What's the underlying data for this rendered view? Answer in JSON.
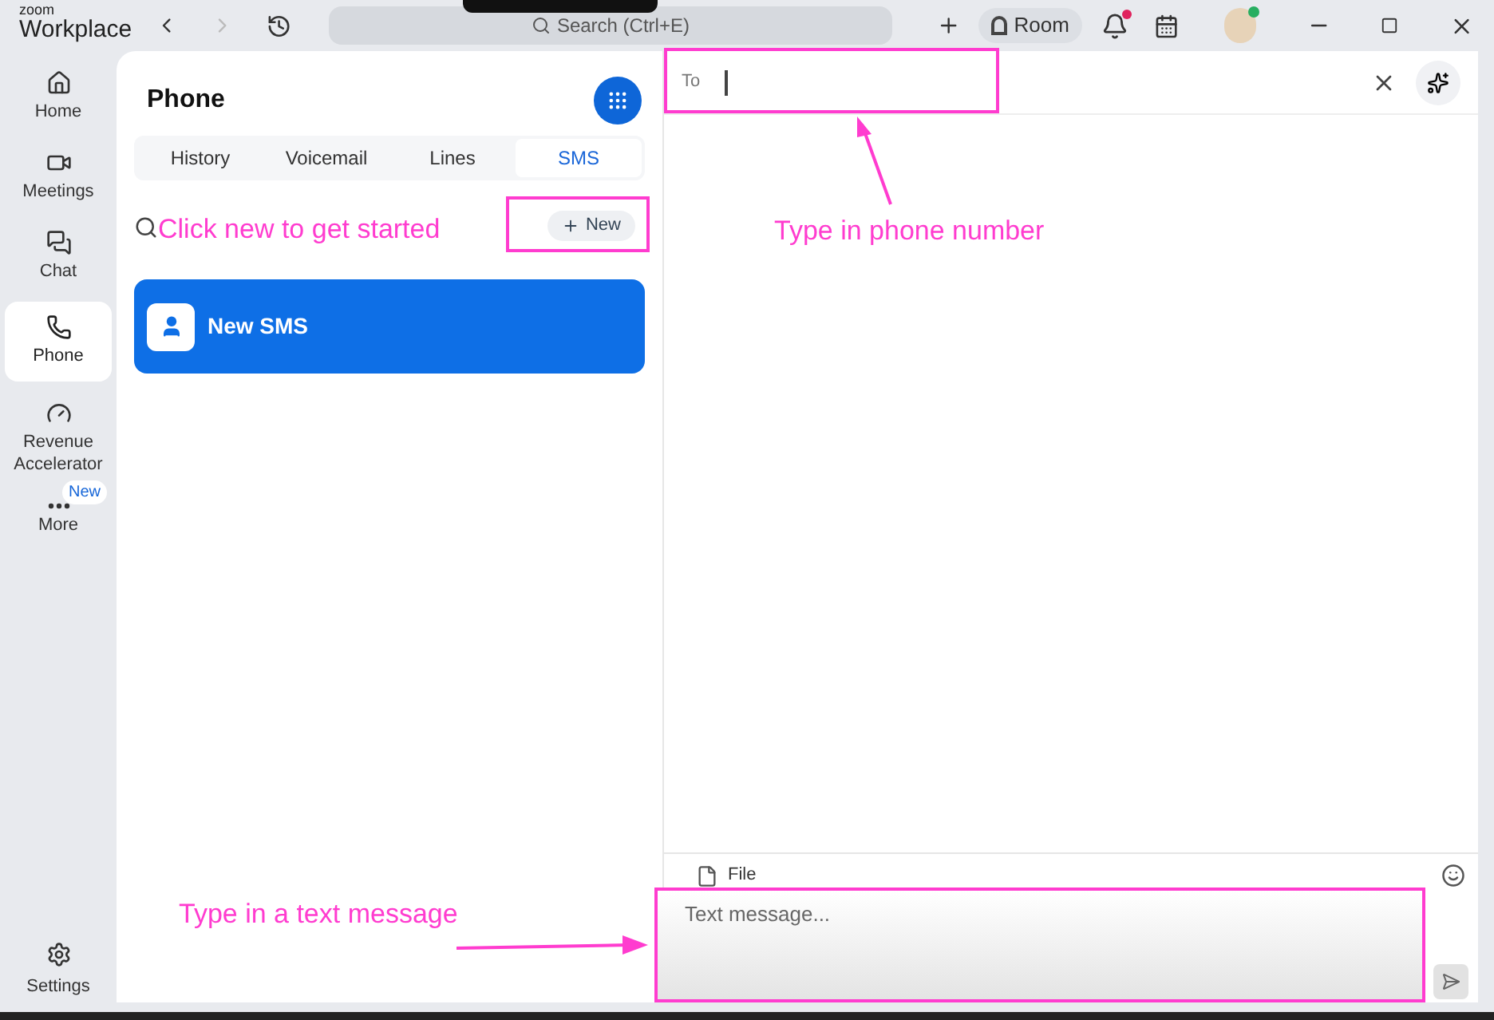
{
  "titlebar": {
    "logo_small": "zoom",
    "logo": "Workplace",
    "search": {
      "placeholder": "Search (Ctrl+E)"
    },
    "room_button": "Room",
    "notifications_unread": true,
    "presence_online": true
  },
  "sidebar": {
    "items": [
      {
        "label": "Home",
        "kind": "home",
        "selected": false
      },
      {
        "label": "Meetings",
        "kind": "video",
        "selected": false
      },
      {
        "label": "Chat",
        "kind": "chat",
        "selected": false
      },
      {
        "label": "Phone",
        "kind": "phone",
        "selected": true
      },
      {
        "label": "Revenue Accelerator",
        "kind": "gauge",
        "selected": false
      },
      {
        "label": "More",
        "kind": "more",
        "selected": false,
        "badge": "New"
      }
    ],
    "settings": "Settings"
  },
  "phone_panel": {
    "title": "Phone",
    "tabs": [
      {
        "label": "History",
        "selected": false
      },
      {
        "label": "Voicemail",
        "selected": false
      },
      {
        "label": "Lines",
        "selected": false
      },
      {
        "label": "SMS",
        "selected": true
      }
    ],
    "new_button": "New",
    "conversations": [
      {
        "title": "New SMS",
        "selected": true
      }
    ]
  },
  "compose": {
    "to_label": "To",
    "attach_label": "File",
    "message": {
      "placeholder": "Text message..."
    }
  },
  "annotations": [
    {
      "kind": "search-hint",
      "text": "Click new to get started"
    },
    {
      "kind": "to-hint",
      "text": "Type in phone number"
    },
    {
      "kind": "message-hint",
      "text": "Type in a text message"
    }
  ]
}
